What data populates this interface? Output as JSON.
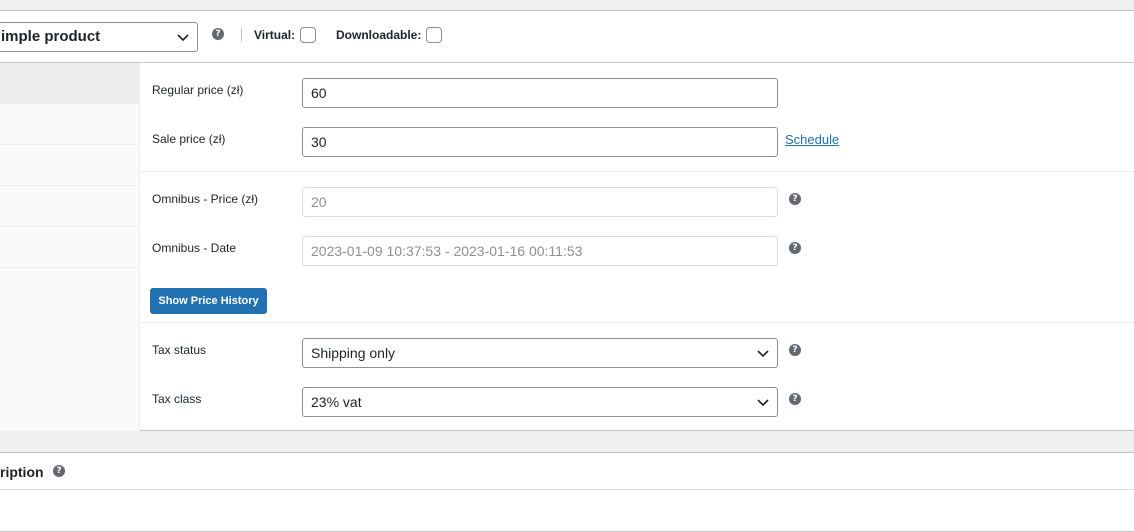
{
  "product_type_bar": {
    "product_type_selected": "imple product",
    "virtual_label": "Virtual:",
    "downloadable_label": "Downloadable:",
    "help_glyph": "?"
  },
  "general": {
    "regular_price_label": "Regular price (zł)",
    "regular_price_value": "60",
    "sale_price_label": "Sale price (zł)",
    "sale_price_value": "30",
    "schedule_link": "Schedule",
    "omnibus_price_label": "Omnibus - Price (zł)",
    "omnibus_price_value": "20",
    "omnibus_date_label": "Omnibus - Date",
    "omnibus_date_value": "2023-01-09 10:37:53 - 2023-01-16 00:11:53",
    "show_history_button": "Show Price History",
    "tax_status_label": "Tax status",
    "tax_status_selected": "Shipping only",
    "tax_class_label": "Tax class",
    "tax_class_selected": "23% vat"
  },
  "description_section": {
    "title": "ription"
  },
  "colors": {
    "accent": "#2271b1",
    "border": "#c3c4c7",
    "background": "#f0f0f1"
  }
}
